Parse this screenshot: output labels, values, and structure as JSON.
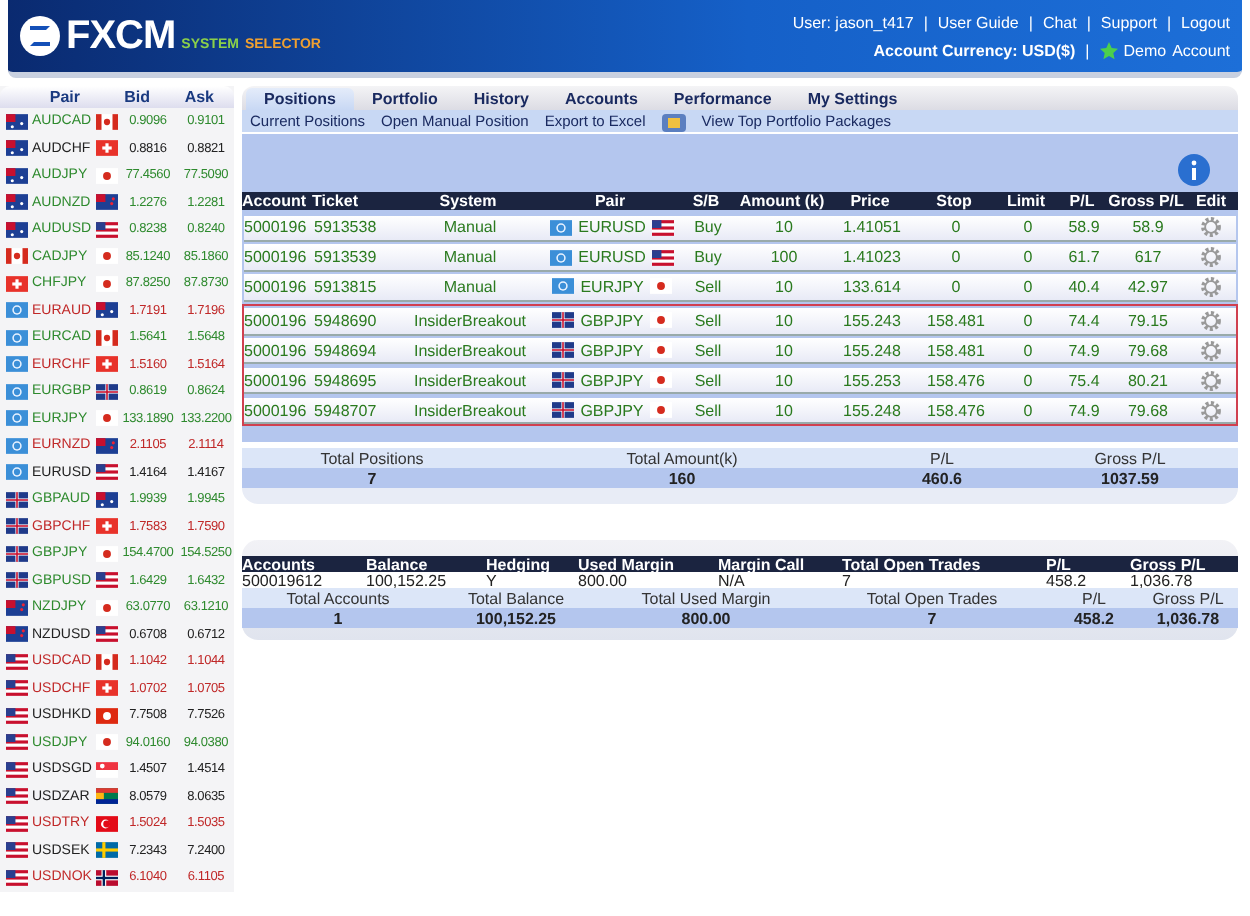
{
  "header": {
    "logo": "FXCM",
    "tagline_1": "SYSTEM",
    "tagline_2": "SELECTOR",
    "user": "User: jason_t417",
    "separators": [
      "|",
      "|",
      "|",
      "|"
    ],
    "links": [
      "User Guide",
      "Chat",
      "Support",
      "Logout"
    ],
    "currency": "Account Currency: USD($)",
    "currency_separator": "|",
    "demo": "Demo",
    "account": "Account"
  },
  "quotes": {
    "columns": [
      "Pair",
      "Bid",
      "Ask"
    ],
    "rows": [
      {
        "pair": "AUDCAD",
        "flags": [
          {
            "kind": "au"
          },
          {
            "kind": "ca"
          }
        ],
        "bid": "0.9096",
        "ask": "0.9101",
        "color": "#2e8a2e"
      },
      {
        "pair": "AUDCHF",
        "flags": [
          {
            "kind": "au"
          },
          {
            "kind": "ch"
          }
        ],
        "bid": "0.8816",
        "ask": "0.8821",
        "color": "#222222"
      },
      {
        "pair": "AUDJPY",
        "flags": [
          {
            "kind": "au"
          },
          {
            "kind": "jp"
          }
        ],
        "bid": "77.4560",
        "ask": "77.5090",
        "color": "#2e8a2e"
      },
      {
        "pair": "AUDNZD",
        "flags": [
          {
            "kind": "au"
          },
          {
            "kind": "nz"
          }
        ],
        "bid": "1.2276",
        "ask": "1.2281",
        "color": "#2e8a2e"
      },
      {
        "pair": "AUDUSD",
        "flags": [
          {
            "kind": "au"
          },
          {
            "kind": "us"
          }
        ],
        "bid": "0.8238",
        "ask": "0.8240",
        "color": "#2e8a2e"
      },
      {
        "pair": "CADJPY",
        "flags": [
          {
            "kind": "ca"
          },
          {
            "kind": "jp"
          }
        ],
        "bid": "85.1240",
        "ask": "85.1860",
        "color": "#2e8a2e"
      },
      {
        "pair": "CHFJPY",
        "flags": [
          {
            "kind": "ch"
          },
          {
            "kind": "jp"
          }
        ],
        "bid": "87.8250",
        "ask": "87.8730",
        "color": "#2e8a2e"
      },
      {
        "pair": "EURAUD",
        "flags": [
          {
            "kind": "eu"
          },
          {
            "kind": "au"
          }
        ],
        "bid": "1.7191",
        "ask": "1.7196",
        "color": "#c02828"
      },
      {
        "pair": "EURCAD",
        "flags": [
          {
            "kind": "eu"
          },
          {
            "kind": "ca"
          }
        ],
        "bid": "1.5641",
        "ask": "1.5648",
        "color": "#2e8a2e"
      },
      {
        "pair": "EURCHF",
        "flags": [
          {
            "kind": "eu"
          },
          {
            "kind": "ch"
          }
        ],
        "bid": "1.5160",
        "ask": "1.5164",
        "color": "#c02828"
      },
      {
        "pair": "EURGBP",
        "flags": [
          {
            "kind": "eu"
          },
          {
            "kind": "gb"
          }
        ],
        "bid": "0.8619",
        "ask": "0.8624",
        "color": "#2e8a2e"
      },
      {
        "pair": "EURJPY",
        "flags": [
          {
            "kind": "eu"
          },
          {
            "kind": "jp"
          }
        ],
        "bid": "133.1890",
        "ask": "133.2200",
        "color": "#2e8a2e"
      },
      {
        "pair": "EURNZD",
        "flags": [
          {
            "kind": "eu"
          },
          {
            "kind": "nz"
          }
        ],
        "bid": "2.1105",
        "ask": "2.1114",
        "color": "#c02828"
      },
      {
        "pair": "EURUSD",
        "flags": [
          {
            "kind": "eu"
          },
          {
            "kind": "us"
          }
        ],
        "bid": "1.4164",
        "ask": "1.4167",
        "color": "#222222"
      },
      {
        "pair": "GBPAUD",
        "flags": [
          {
            "kind": "gb"
          },
          {
            "kind": "au"
          }
        ],
        "bid": "1.9939",
        "ask": "1.9945",
        "color": "#2e8a2e"
      },
      {
        "pair": "GBPCHF",
        "flags": [
          {
            "kind": "gb"
          },
          {
            "kind": "ch"
          }
        ],
        "bid": "1.7583",
        "ask": "1.7590",
        "color": "#c02828"
      },
      {
        "pair": "GBPJPY",
        "flags": [
          {
            "kind": "gb"
          },
          {
            "kind": "jp"
          }
        ],
        "bid": "154.4700",
        "ask": "154.5250",
        "color": "#2e8a2e"
      },
      {
        "pair": "GBPUSD",
        "flags": [
          {
            "kind": "gb"
          },
          {
            "kind": "us"
          }
        ],
        "bid": "1.6429",
        "ask": "1.6432",
        "color": "#2e8a2e"
      },
      {
        "pair": "NZDJPY",
        "flags": [
          {
            "kind": "nz"
          },
          {
            "kind": "jp"
          }
        ],
        "bid": "63.0770",
        "ask": "63.1210",
        "color": "#2e8a2e"
      },
      {
        "pair": "NZDUSD",
        "flags": [
          {
            "kind": "nz"
          },
          {
            "kind": "us"
          }
        ],
        "bid": "0.6708",
        "ask": "0.6712",
        "color": "#222222"
      },
      {
        "pair": "USDCAD",
        "flags": [
          {
            "kind": "us"
          },
          {
            "kind": "ca"
          }
        ],
        "bid": "1.1042",
        "ask": "1.1044",
        "color": "#c02828"
      },
      {
        "pair": "USDCHF",
        "flags": [
          {
            "kind": "us"
          },
          {
            "kind": "ch"
          }
        ],
        "bid": "1.0702",
        "ask": "1.0705",
        "color": "#c02828"
      },
      {
        "pair": "USDHKD",
        "flags": [
          {
            "kind": "us"
          },
          {
            "kind": "hk"
          }
        ],
        "bid": "7.7508",
        "ask": "7.7526",
        "color": "#222222"
      },
      {
        "pair": "USDJPY",
        "flags": [
          {
            "kind": "us"
          },
          {
            "kind": "jp"
          }
        ],
        "bid": "94.0160",
        "ask": "94.0380",
        "color": "#2e8a2e"
      },
      {
        "pair": "USDSGD",
        "flags": [
          {
            "kind": "us"
          },
          {
            "kind": "sg"
          }
        ],
        "bid": "1.4507",
        "ask": "1.4514",
        "color": "#222222"
      },
      {
        "pair": "USDZAR",
        "flags": [
          {
            "kind": "us"
          },
          {
            "kind": "za"
          }
        ],
        "bid": "8.0579",
        "ask": "8.0635",
        "color": "#222222"
      },
      {
        "pair": "USDTRY",
        "flags": [
          {
            "kind": "us"
          },
          {
            "kind": "tr"
          }
        ],
        "bid": "1.5024",
        "ask": "1.5035",
        "color": "#c02828"
      },
      {
        "pair": "USDSEK",
        "flags": [
          {
            "kind": "us"
          },
          {
            "kind": "se"
          }
        ],
        "bid": "7.2343",
        "ask": "7.2400",
        "color": "#222222"
      },
      {
        "pair": "USDNOK",
        "flags": [
          {
            "kind": "us"
          },
          {
            "kind": "no"
          }
        ],
        "bid": "6.1040",
        "ask": "6.1105",
        "color": "#c02828"
      }
    ]
  },
  "tabs": [
    {
      "label": "Positions",
      "selected": true
    },
    {
      "label": "Portfolio",
      "selected": false
    },
    {
      "label": "History",
      "selected": false
    },
    {
      "label": "Accounts",
      "selected": false
    },
    {
      "label": "Performance",
      "selected": false
    },
    {
      "label": "My Settings",
      "selected": false
    }
  ],
  "subnav": [
    "Current Positions",
    "Open Manual Position",
    "Export to Excel",
    "View Top Portfolio Packages"
  ],
  "positions": {
    "columns": [
      "Account",
      "Ticket",
      "System",
      "Pair",
      "S/B",
      "Amount (k)",
      "Price",
      "Stop",
      "Limit",
      "P/L",
      "Gross P/L",
      "Edit"
    ],
    "groups": [
      {
        "highlighted": false,
        "rows": [
          {
            "account": "5000196",
            "ticket": "5913538",
            "system": "Manual",
            "pair": "EURUSD",
            "flags": [
              {
                "kind": "eu"
              },
              {
                "kind": "us"
              }
            ],
            "side": "Buy",
            "amount": "10",
            "price": "1.41051",
            "stop": "0",
            "limit": "0",
            "pl": "58.9",
            "gross": "58.9"
          },
          {
            "account": "5000196",
            "ticket": "5913539",
            "system": "Manual",
            "pair": "EURUSD",
            "flags": [
              {
                "kind": "eu"
              },
              {
                "kind": "us"
              }
            ],
            "side": "Buy",
            "amount": "100",
            "price": "1.41023",
            "stop": "0",
            "limit": "0",
            "pl": "61.7",
            "gross": "617"
          },
          {
            "account": "5000196",
            "ticket": "5913815",
            "system": "Manual",
            "pair": "EURJPY",
            "flags": [
              {
                "kind": "eu"
              },
              {
                "kind": "jp"
              }
            ],
            "side": "Sell",
            "amount": "10",
            "price": "133.614",
            "stop": "0",
            "limit": "0",
            "pl": "40.4",
            "gross": "42.97"
          }
        ]
      },
      {
        "highlighted": true,
        "rows": [
          {
            "account": "5000196",
            "ticket": "5948690",
            "system": "InsiderBreakout",
            "pair": "GBPJPY",
            "flags": [
              {
                "kind": "gb"
              },
              {
                "kind": "jp"
              }
            ],
            "side": "Sell",
            "amount": "10",
            "price": "155.243",
            "stop": "158.481",
            "limit": "0",
            "pl": "74.4",
            "gross": "79.15"
          },
          {
            "account": "5000196",
            "ticket": "5948694",
            "system": "InsiderBreakout",
            "pair": "GBPJPY",
            "flags": [
              {
                "kind": "gb"
              },
              {
                "kind": "jp"
              }
            ],
            "side": "Sell",
            "amount": "10",
            "price": "155.248",
            "stop": "158.481",
            "limit": "0",
            "pl": "74.9",
            "gross": "79.68"
          },
          {
            "account": "5000196",
            "ticket": "5948695",
            "system": "InsiderBreakout",
            "pair": "GBPJPY",
            "flags": [
              {
                "kind": "gb"
              },
              {
                "kind": "jp"
              }
            ],
            "side": "Sell",
            "amount": "10",
            "price": "155.253",
            "stop": "158.476",
            "limit": "0",
            "pl": "75.4",
            "gross": "80.21"
          },
          {
            "account": "5000196",
            "ticket": "5948707",
            "system": "InsiderBreakout",
            "pair": "GBPJPY",
            "flags": [
              {
                "kind": "gb"
              },
              {
                "kind": "jp"
              }
            ],
            "side": "Sell",
            "amount": "10",
            "price": "155.248",
            "stop": "158.476",
            "limit": "0",
            "pl": "74.9",
            "gross": "79.68"
          }
        ]
      }
    ]
  },
  "position_totals": {
    "labels": [
      "Total Positions",
      "Total Amount(k)",
      "P/L",
      "Gross P/L"
    ],
    "values": [
      "7",
      "160",
      "460.6",
      "1037.59"
    ]
  },
  "accounts": {
    "columns": [
      "Accounts",
      "Balance",
      "Hedging",
      "Used Margin",
      "Margin Call",
      "Total Open Trades",
      "P/L",
      "Gross P/L"
    ],
    "row": [
      "500019612",
      "100,152.25",
      "Y",
      "800.00",
      "N/A",
      "7",
      "458.2",
      "1,036.78"
    ],
    "total_labels": [
      "Total Accounts",
      "Total Balance",
      "Total Used Margin",
      "Total Open Trades",
      "P/L",
      "Gross P/L"
    ],
    "total_values": [
      "1",
      "100,152.25",
      "800.00",
      "7",
      "458.2",
      "1,036.78"
    ]
  }
}
